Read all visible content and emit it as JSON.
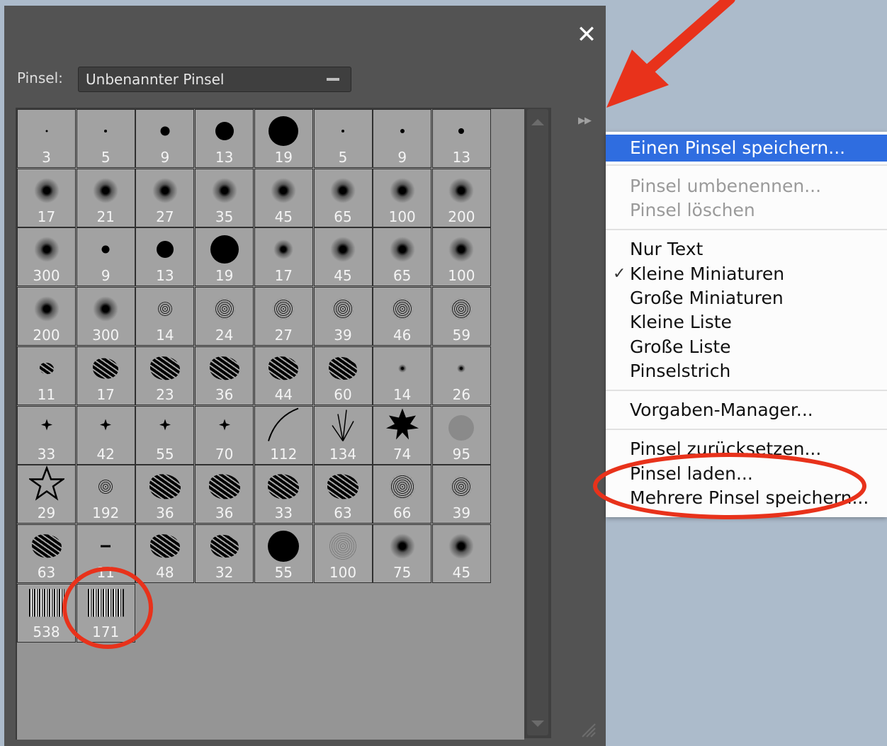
{
  "panel": {
    "brush_label": "Pinsel:",
    "brush_value": "Unbenannter Pinsel"
  },
  "brush_grid": [
    [
      "3",
      "5",
      "9",
      "13",
      "19",
      "5",
      "9",
      "13"
    ],
    [
      "17",
      "21",
      "27",
      "35",
      "45",
      "65",
      "100",
      "200"
    ],
    [
      "300",
      "9",
      "13",
      "19",
      "17",
      "45",
      "65",
      "100"
    ],
    [
      "200",
      "300",
      "14",
      "24",
      "27",
      "39",
      "46",
      "59"
    ],
    [
      "11",
      "17",
      "23",
      "36",
      "44",
      "60",
      "14",
      "26"
    ],
    [
      "33",
      "42",
      "55",
      "70",
      "112",
      "134",
      "74",
      "95"
    ],
    [
      "29",
      "192",
      "36",
      "36",
      "33",
      "63",
      "66",
      "39"
    ],
    [
      "63",
      "11",
      "48",
      "32",
      "55",
      "100",
      "75",
      "45"
    ],
    [
      "538",
      "171"
    ]
  ],
  "menu": {
    "items": [
      {
        "label": "Einen Pinsel speichern...",
        "state": "highlighted"
      },
      {
        "label": "Pinsel umbenennen...",
        "state": "disabled"
      },
      {
        "label": "Pinsel löschen",
        "state": "disabled"
      },
      {
        "label": "Nur Text",
        "state": "normal"
      },
      {
        "label": "Kleine Miniaturen",
        "state": "checked"
      },
      {
        "label": "Große Miniaturen",
        "state": "normal"
      },
      {
        "label": "Kleine Liste",
        "state": "normal"
      },
      {
        "label": "Große Liste",
        "state": "normal"
      },
      {
        "label": "Pinselstrich",
        "state": "normal"
      },
      {
        "label": "Vorgaben-Manager...",
        "state": "normal"
      },
      {
        "label": "Pinsel zurücksetzen...",
        "state": "normal"
      },
      {
        "label": "Pinsel laden...",
        "state": "normal"
      },
      {
        "label": "Mehrere Pinsel speichern...",
        "state": "normal"
      }
    ],
    "check_mark": "✓"
  },
  "colors": {
    "background": "#acbbcb",
    "panel": "#535353",
    "highlight": "#2f6de0",
    "annotation": "#e8321b"
  },
  "icons": [
    "close-icon",
    "panel-menu-icon",
    "dropdown-arrow-icon",
    "annotation-arrow-icon",
    "resize-grip-icon"
  ]
}
